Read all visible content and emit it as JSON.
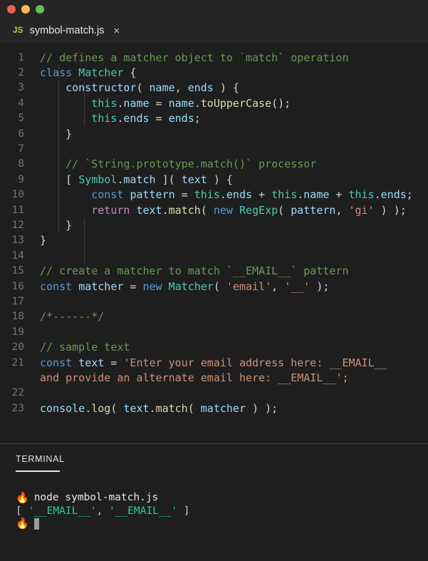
{
  "window": {
    "controls": [
      {
        "name": "close",
        "color": "#ef5f56"
      },
      {
        "name": "minimize",
        "color": "#f5bd4f"
      },
      {
        "name": "maximize",
        "color": "#5fc454"
      }
    ]
  },
  "tab": {
    "icon_label": "JS",
    "filename": "symbol-match.js",
    "close_glyph": "×"
  },
  "editor": {
    "lines": [
      {
        "num": "1",
        "text": "// defines a matcher object to `match` operation"
      },
      {
        "num": "2",
        "text": "class Matcher {"
      },
      {
        "num": "3",
        "text": "    constructor( name, ends ) {"
      },
      {
        "num": "4",
        "text": "        this.name = name.toUpperCase();"
      },
      {
        "num": "5",
        "text": "        this.ends = ends;"
      },
      {
        "num": "6",
        "text": "    }"
      },
      {
        "num": "7",
        "text": ""
      },
      {
        "num": "8",
        "text": "    // `String.prototype.match()` processor"
      },
      {
        "num": "9",
        "text": "    [ Symbol.match ]( text ) {"
      },
      {
        "num": "10",
        "text": "        const pattern = this.ends + this.name + this.ends;"
      },
      {
        "num": "11",
        "text": "        return text.match( new RegExp( pattern, 'gi' ) );"
      },
      {
        "num": "12",
        "text": "    }"
      },
      {
        "num": "13",
        "text": "}"
      },
      {
        "num": "14",
        "text": ""
      },
      {
        "num": "15",
        "text": "// create a matcher to match `__EMAIL__` pattern"
      },
      {
        "num": "16",
        "text": "const matcher = new Matcher( 'email', '__' );"
      },
      {
        "num": "17",
        "text": ""
      },
      {
        "num": "18",
        "text": "/*------*/"
      },
      {
        "num": "19",
        "text": ""
      },
      {
        "num": "20",
        "text": "// sample text"
      },
      {
        "num": "21",
        "text": "const text = 'Enter your email address here: __EMAIL__"
      },
      {
        "num": "",
        "text": "and provide an alternate email here: __EMAIL__';"
      },
      {
        "num": "22",
        "text": ""
      },
      {
        "num": "23",
        "text": "console.log( text.match( matcher ) );"
      }
    ]
  },
  "terminal": {
    "title": "TERMINAL",
    "prompt_glyph": "🔥",
    "command": "node symbol-match.js",
    "output_open": "[ ",
    "output_value_1": "'__EMAIL__'",
    "output_comma": ", ",
    "output_value_2": "'__EMAIL__'",
    "output_close": " ]"
  },
  "colors": {
    "editor_bg": "#1e1e1e",
    "chrome_bg": "#252526",
    "comment": "#6a9955",
    "keyword": "#569cd6",
    "control": "#c586c0",
    "type": "#4ec9b0",
    "function": "#dcdcaa",
    "variable": "#9cdcfe",
    "string": "#ce9178",
    "line_number": "#6e7681",
    "terminal_green": "#23d18b",
    "tab_icon": "#cbcb41"
  }
}
